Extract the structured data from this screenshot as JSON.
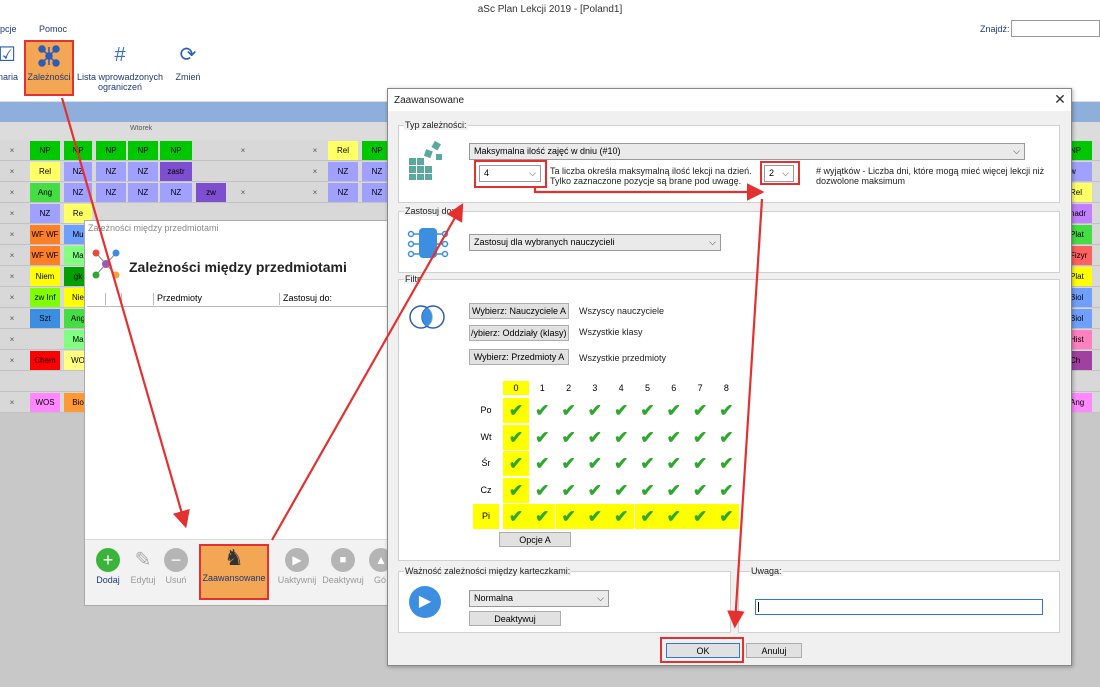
{
  "window": {
    "title": "aSc Plan Lekcji 2019  - [Poland1]"
  },
  "menu": {
    "items": [
      "pcje",
      "Pomoc"
    ],
    "find_label": "Znajdź:"
  },
  "ribbon": {
    "buttons": [
      {
        "label": "inaria",
        "icon": "calendar-check-icon"
      },
      {
        "label": "Zależności",
        "icon": "network-icon"
      },
      {
        "label": "Lista wprowadzonych ograniczeń",
        "icon": "hash-grid-icon"
      },
      {
        "label": "Zmień",
        "icon": "user-swap-icon"
      }
    ]
  },
  "timetable": {
    "day_label": "Wtorek",
    "rows": [
      {
        "left": [
          "×",
          "NP",
          "NP",
          "NP",
          "NP",
          "NP",
          "",
          "×"
        ],
        "right": [
          "×",
          "Rel",
          "NP"
        ],
        "strip": "NP"
      },
      {
        "left": [
          "×",
          "Rel",
          "NZ",
          "NZ",
          "NZ",
          "zastr",
          "",
          ""
        ],
        "right": [
          "×",
          "NZ",
          "NZ"
        ],
        "strip": "w"
      },
      {
        "left": [
          "×",
          "Ang",
          "NZ",
          "NZ",
          "NZ",
          "NZ",
          "zw",
          "×"
        ],
        "right": [
          "×",
          "NZ",
          "NZ"
        ],
        "strip": "Rel"
      },
      {
        "left": [
          "×",
          "NZ",
          "Re"
        ],
        "right": [],
        "strip": "nadr"
      },
      {
        "left": [
          "×",
          "WF WF",
          "Mu"
        ],
        "right": [],
        "strip": "Plat"
      },
      {
        "left": [
          "×",
          "WF WF",
          "Ma"
        ],
        "right": [],
        "strip": "Fizyr"
      },
      {
        "left": [
          "×",
          "Niem",
          "gk"
        ],
        "right": [],
        "strip": "Plat"
      },
      {
        "left": [
          "×",
          "zw Inf",
          "Nie"
        ],
        "right": [],
        "strip": "Biol"
      },
      {
        "left": [
          "×",
          "Szt",
          "Ang"
        ],
        "right": [],
        "strip": "Biol"
      },
      {
        "left": [
          "×",
          "",
          "Ma"
        ],
        "right": [],
        "strip": "Hist"
      },
      {
        "left": [
          "×",
          "Chem",
          "WO"
        ],
        "right": [],
        "strip": "Ch"
      },
      {
        "left": [
          "",
          "",
          ""
        ],
        "right": [],
        "strip": ""
      },
      {
        "left": [
          "×",
          "WOS",
          "Bio"
        ],
        "right": [],
        "strip": "Ang"
      }
    ]
  },
  "dependencies_window": {
    "title": "Zależności między przedmiotami",
    "heading": "Zależności między przedmiotami",
    "columns": [
      "Przedmioty",
      "Zastosuj do:"
    ],
    "toolbar": [
      {
        "label": "Dodaj",
        "icon": "plus-circle-icon",
        "enabled": true
      },
      {
        "label": "Edytuj",
        "icon": "pencil-icon",
        "enabled": false
      },
      {
        "label": "Usuń",
        "icon": "minus-circle-icon",
        "enabled": false
      },
      {
        "label": "Zaawansowane",
        "icon": "chess-knight-plus-icon",
        "enabled": true
      },
      {
        "label": "Uaktywnij",
        "icon": "play-circle-icon",
        "enabled": false
      },
      {
        "label": "Deaktywuj",
        "icon": "stop-circle-icon",
        "enabled": false
      },
      {
        "label": "Gó",
        "icon": "up-circle-icon",
        "enabled": false
      }
    ]
  },
  "advanced_dialog": {
    "title": "Zaawansowane",
    "type_group": {
      "label": "Typ zależności:",
      "selected": "Maksymalna ilość zajęć w dniu (#10)",
      "max_value": "4",
      "max_desc": "Ta liczba określa maksymalną ilość lekcji na dzień. Tylko zaznaczone pozycje są brane pod uwagę.",
      "exceptions_value": "2",
      "exceptions_desc": "# wyjątków - Liczba dni, które mogą mieć więcej lekcji niż dozwolone maksimum"
    },
    "apply_group": {
      "label": "Zastosuj do:",
      "selected": "Zastosuj dla wybranych nauczycieli"
    },
    "filter_group": {
      "label": "Filtr",
      "rows": [
        {
          "button": "Wybierz: Nauczyciele A",
          "value": "Wszyscy nauczyciele"
        },
        {
          "button": "/ybierz: Oddziały (klasy) A",
          "value": "Wszystkie klasy"
        },
        {
          "button": "Wybierz: Przedmioty A",
          "value": "Wszystkie przedmioty"
        }
      ],
      "periods": [
        "0",
        "1",
        "2",
        "3",
        "4",
        "5",
        "6",
        "7",
        "8"
      ],
      "days": [
        "Po",
        "Wt",
        "Śr",
        "Cz",
        "Pi"
      ],
      "options_button": "Opcje A"
    },
    "importance_group": {
      "label": "Ważność zależności między karteczkami:",
      "selected": "Normalna",
      "deactivate_button": "Deaktywuj"
    },
    "note_group": {
      "label": "Uwaga:",
      "value": ""
    },
    "ok_button": "OK",
    "cancel_button": "Anuluj"
  },
  "colors": {
    "highlight_orange": "#f3a654",
    "annotation_red": "#e53030",
    "check_green": "#2ea82e",
    "period_yellow": "#ffff00"
  }
}
